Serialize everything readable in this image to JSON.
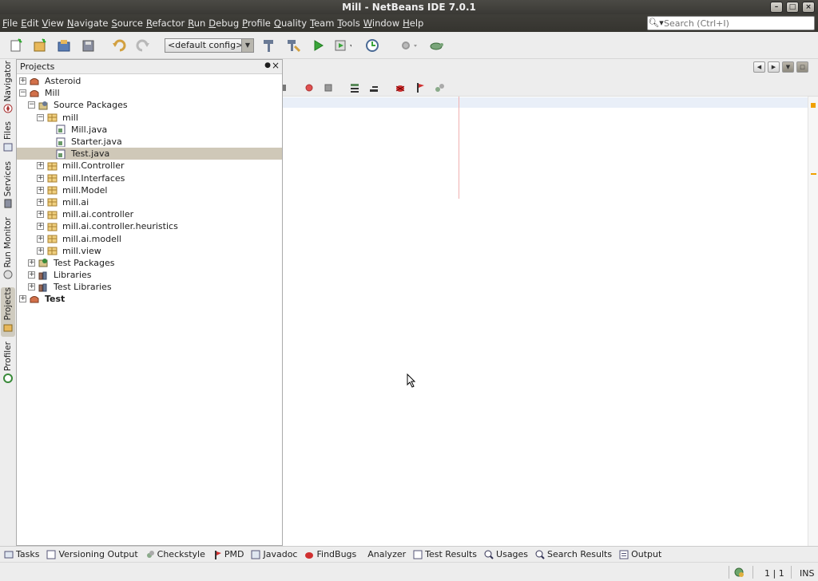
{
  "window": {
    "title": "Mill - NetBeans IDE 7.0.1",
    "controls": [
      "–",
      "□",
      "×"
    ]
  },
  "menubar": {
    "items": [
      "File",
      "Edit",
      "View",
      "Navigate",
      "Source",
      "Refactor",
      "Run",
      "Debug",
      "Profile",
      "Quality",
      "Team",
      "Tools",
      "Window",
      "Help"
    ],
    "search_placeholder": "Search (Ctrl+I)"
  },
  "toolbar": {
    "config_selected": "<default config>",
    "buttons": [
      "new-file-icon",
      "new-project-icon",
      "open-project-icon",
      "save-all-icon",
      "undo-icon",
      "redo-icon",
      "build-hammer-icon",
      "clean-build-icon",
      "run-icon",
      "debug-icon",
      "profile-icon",
      "gear-icon",
      "turtle-icon"
    ]
  },
  "left_tabs": [
    {
      "label": "Navigator",
      "icon": "navigator-icon",
      "active": false
    },
    {
      "label": "Files",
      "icon": "files-icon",
      "active": false
    },
    {
      "label": "Services",
      "icon": "services-icon",
      "active": false
    },
    {
      "label": "Run Monitor",
      "icon": "run-monitor-icon",
      "active": false
    },
    {
      "label": "Projects",
      "icon": "projects-icon",
      "active": true
    },
    {
      "label": "Profiler",
      "icon": "profiler-icon",
      "active": false
    }
  ],
  "projects_panel": {
    "title": "Projects",
    "minimize": "●",
    "close": "×",
    "tree": [
      {
        "level": 0,
        "expander": "+",
        "icon": "project",
        "label": "Asteroid",
        "bold": false
      },
      {
        "level": 0,
        "expander": "−",
        "icon": "project",
        "label": "Mill",
        "bold": false
      },
      {
        "level": 1,
        "expander": "−",
        "icon": "source-packages",
        "label": "Source Packages",
        "bold": false
      },
      {
        "level": 2,
        "expander": "−",
        "icon": "package",
        "label": "mill",
        "bold": false
      },
      {
        "level": 3,
        "expander": "",
        "icon": "java-file",
        "label": "Mill.java",
        "bold": false
      },
      {
        "level": 3,
        "expander": "",
        "icon": "java-file",
        "label": "Starter.java",
        "bold": false
      },
      {
        "level": 3,
        "expander": "",
        "icon": "java-file",
        "label": "Test.java",
        "bold": false,
        "selected": true
      },
      {
        "level": 2,
        "expander": "+",
        "icon": "package",
        "label": "mill.Controller",
        "bold": false
      },
      {
        "level": 2,
        "expander": "+",
        "icon": "package",
        "label": "mill.Interfaces",
        "bold": false
      },
      {
        "level": 2,
        "expander": "+",
        "icon": "package",
        "label": "mill.Model",
        "bold": false
      },
      {
        "level": 2,
        "expander": "+",
        "icon": "package",
        "label": "mill.ai",
        "bold": false
      },
      {
        "level": 2,
        "expander": "+",
        "icon": "package",
        "label": "mill.ai.controller",
        "bold": false
      },
      {
        "level": 2,
        "expander": "+",
        "icon": "package",
        "label": "mill.ai.controller.heuristics",
        "bold": false
      },
      {
        "level": 2,
        "expander": "+",
        "icon": "package",
        "label": "mill.ai.modell",
        "bold": false
      },
      {
        "level": 2,
        "expander": "+",
        "icon": "package",
        "label": "mill.view",
        "bold": false
      },
      {
        "level": 1,
        "expander": "+",
        "icon": "test-packages",
        "label": "Test Packages",
        "bold": false
      },
      {
        "level": 1,
        "expander": "+",
        "icon": "libraries",
        "label": "Libraries",
        "bold": false
      },
      {
        "level": 1,
        "expander": "+",
        "icon": "libraries",
        "label": "Test Libraries",
        "bold": false
      },
      {
        "level": 0,
        "expander": "+",
        "icon": "project",
        "label": "Test",
        "bold": true
      }
    ]
  },
  "editor_toolbar": [
    "record-icon",
    "stop-icon",
    "comment-icon",
    "uncomment-icon",
    "bug-icon",
    "flag-icon",
    "macro-icon"
  ],
  "bottom_tabs": [
    {
      "label": "Tasks",
      "icon": "tasks-icon"
    },
    {
      "label": "Versioning Output",
      "icon": "versioning-icon"
    },
    {
      "label": "Checkstyle",
      "icon": "checkstyle-icon"
    },
    {
      "label": "PMD",
      "icon": "pmd-icon"
    },
    {
      "label": "Javadoc",
      "icon": "javadoc-icon"
    },
    {
      "label": "FindBugs",
      "icon": "findbugs-icon"
    },
    {
      "label": "Analyzer",
      "icon": ""
    },
    {
      "label": "Test Results",
      "icon": "test-results-icon"
    },
    {
      "label": "Usages",
      "icon": "usages-icon"
    },
    {
      "label": "Search Results",
      "icon": "search-results-icon"
    },
    {
      "label": "Output",
      "icon": "output-icon"
    }
  ],
  "statusbar": {
    "position": "1 | 1",
    "mode": "INS"
  },
  "colors": {
    "title_bg": "#3c3b37",
    "selection": "#cfc8b8",
    "current_line": "#e9eff8",
    "accent_orange": "#f0a000"
  }
}
